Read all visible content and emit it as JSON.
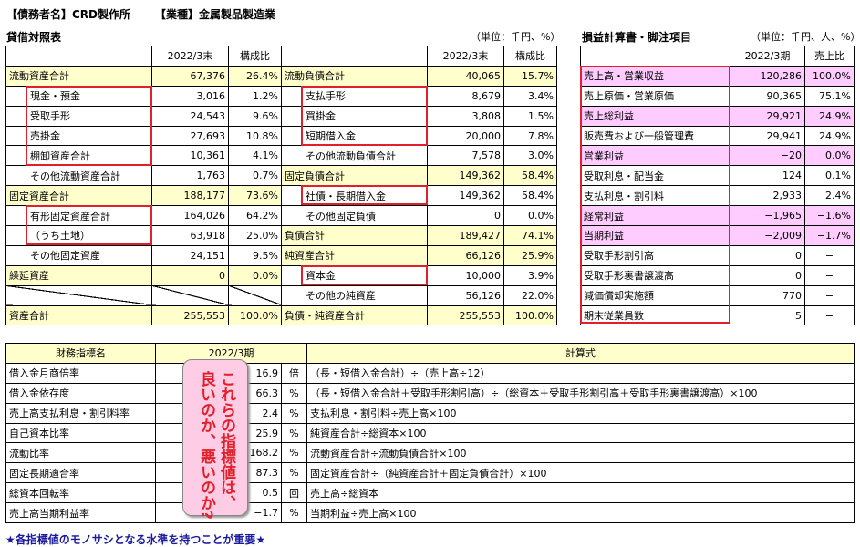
{
  "header": {
    "company": "【債務者名】CRD製作所",
    "industry": "【業種】金属製品製造業"
  },
  "bs": {
    "title": "貸借対照表",
    "unit": "（単位：千円、%）",
    "col_period": "2022/3末",
    "col_ratio": "構成比",
    "rows": [
      {
        "l": "流動資産合計",
        "lv": "67,376",
        "lr": "26.4%",
        "r": "流動負債合計",
        "rv": "40,065",
        "rr": "15.7%"
      },
      {
        "l": "現金・預金",
        "lv": "3,016",
        "lr": "1.2%",
        "r": "支払手形",
        "rv": "8,679",
        "rr": "3.4%"
      },
      {
        "l": "受取手形",
        "lv": "24,543",
        "lr": "9.6%",
        "r": "買掛金",
        "rv": "3,808",
        "rr": "1.5%"
      },
      {
        "l": "売掛金",
        "lv": "27,693",
        "lr": "10.8%",
        "r": "短期借入金",
        "rv": "20,000",
        "rr": "7.8%"
      },
      {
        "l": "棚卸資産合計",
        "lv": "10,361",
        "lr": "4.1%",
        "r": "その他流動負債合計",
        "rv": "7,578",
        "rr": "3.0%"
      },
      {
        "l": "その他流動資産合計",
        "lv": "1,763",
        "lr": "0.7%",
        "r": "固定負債合計",
        "rv": "149,362",
        "rr": "58.4%"
      },
      {
        "l": "固定資産合計",
        "lv": "188,177",
        "lr": "73.6%",
        "r": "社債・長期借入金",
        "rv": "149,362",
        "rr": "58.4%"
      },
      {
        "l": "有形固定資産合計",
        "lv": "164,026",
        "lr": "64.2%",
        "r": "その他固定負債",
        "rv": "0",
        "rr": "0.0%"
      },
      {
        "l": "（うち土地）",
        "lv": "63,918",
        "lr": "25.0%",
        "r": "負債合計",
        "rv": "189,427",
        "rr": "74.1%"
      },
      {
        "l": "その他固定資産",
        "lv": "24,151",
        "lr": "9.5%",
        "r": "純資産合計",
        "rv": "66,126",
        "rr": "25.9%"
      },
      {
        "l": "繰延資産",
        "lv": "0",
        "lr": "0.0%",
        "r": "資本金",
        "rv": "10,000",
        "rr": "3.9%"
      },
      {
        "l": "",
        "lv": "",
        "lr": "",
        "r": "その他の純資産",
        "rv": "56,126",
        "rr": "22.0%"
      },
      {
        "l": "資産合計",
        "lv": "255,553",
        "lr": "100.0%",
        "r": "負債・純資産合計",
        "rv": "255,553",
        "rr": "100.0%"
      }
    ]
  },
  "pl": {
    "title": "損益計算書・脚注項目",
    "unit": "（単位：千円、人、%）",
    "col_period": "2022/3期",
    "col_ratio": "売上比",
    "rows": [
      {
        "l": "売上高・営業収益",
        "v": "120,286",
        "r": "100.0%"
      },
      {
        "l": "売上原価・営業原価",
        "v": "90,365",
        "r": "75.1%"
      },
      {
        "l": "売上総利益",
        "v": "29,921",
        "r": "24.9%"
      },
      {
        "l": "販売費および一般管理費",
        "v": "29,941",
        "r": "24.9%"
      },
      {
        "l": "営業利益",
        "v": "−20",
        "r": "0.0%"
      },
      {
        "l": "受取利息・配当金",
        "v": "124",
        "r": "0.1%"
      },
      {
        "l": "支払利息・割引料",
        "v": "2,933",
        "r": "2.4%"
      },
      {
        "l": "経常利益",
        "v": "−1,965",
        "r": "−1.6%"
      },
      {
        "l": "当期利益",
        "v": "−2,009",
        "r": "−1.7%"
      },
      {
        "l": "受取手形割引高",
        "v": "0",
        "r": "−"
      },
      {
        "l": "受取手形裏書譲渡高",
        "v": "0",
        "r": "−"
      },
      {
        "l": "減価償却実施額",
        "v": "770",
        "r": "−"
      },
      {
        "l": "期末従業員数",
        "v": "5",
        "r": "−"
      }
    ]
  },
  "fi": {
    "col_name": "財務指標名",
    "col_period": "2022/3期",
    "col_formula": "計算式",
    "rows": [
      {
        "n": "借入金月商倍率",
        "v": "16.9",
        "u": "倍",
        "f": "（長・短借入金合計）÷（売上高÷12）"
      },
      {
        "n": "借入金依存度",
        "v": "66.3",
        "u": "%",
        "f": "（長・短借入金合計＋受取手形割引高）÷（総資本＋受取手形割引高＋受取手形裏書譲渡高）×100"
      },
      {
        "n": "売上高支払利息・割引料率",
        "v": "2.4",
        "u": "%",
        "f": "支払利息・割引料÷売上高×100"
      },
      {
        "n": "自己資本比率",
        "v": "25.9",
        "u": "%",
        "f": "純資産合計÷総資本×100"
      },
      {
        "n": "流動比率",
        "v": "168.2",
        "u": "%",
        "f": "流動資産合計÷流動負債合計×100"
      },
      {
        "n": "固定長期適合率",
        "v": "87.3",
        "u": "%",
        "f": "固定資産合計÷（純資産合計＋固定負債合計）×100"
      },
      {
        "n": "総資本回転率",
        "v": "0.5",
        "u": "回",
        "f": "売上高÷総資本"
      },
      {
        "n": "売上高当期利益率",
        "v": "−1.7",
        "u": "%",
        "f": "当期利益÷売上高×100"
      }
    ]
  },
  "bubble": {
    "line1": "これらの指標値は、",
    "line2": "良いのか、悪いのか?"
  },
  "footer": "★各指標値のモノサシとなる水準を持つことが重要★",
  "colors": {
    "yellow": "#ffffcc",
    "pink": "#ffccff",
    "red": "#e0202a",
    "navy": "#1a1aa0"
  }
}
